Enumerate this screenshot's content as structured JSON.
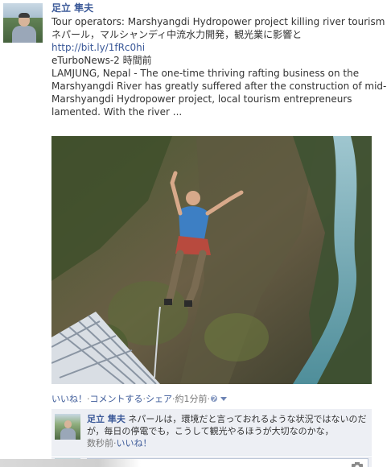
{
  "post": {
    "author": "足立 隼夫",
    "title_en": "Tour operators: Marshyangdi Hydropower project killing river tourism",
    "title_ja": "ネパール，マルシャンディ中流水力開発，観光業に影響と",
    "link": "http://bit.ly/1fRc0hi",
    "source": "eTurboNews-2 時間前",
    "description": "LAMJUNG, Nepal - The one-time thriving rafting business on the Marshyangdi River has greatly suffered after the construction of mid-Marshyangdi Hydropower project, local tourism entrepreneurs lamented. With the river ...",
    "photo_icon": "bungee-jump-photo"
  },
  "actions": {
    "like": "いいね！",
    "comment": "コメントする",
    "share": "シェア",
    "time": "約1分前",
    "dot": "·",
    "audience_icon": "globe-icon"
  },
  "comment": {
    "author": "足立 隼夫",
    "text": "ネパールは，環境だと言っておれるような状況ではないのだが，毎日の停電でも，こうして観光やるほうが大切なのかな，",
    "time": "数秒前",
    "like": "いいね！"
  },
  "composer": {
    "camera_icon": "camera-icon"
  },
  "colors": {
    "link": "#3b5998",
    "comment_bg": "#edeff4",
    "meta": "#777777"
  }
}
